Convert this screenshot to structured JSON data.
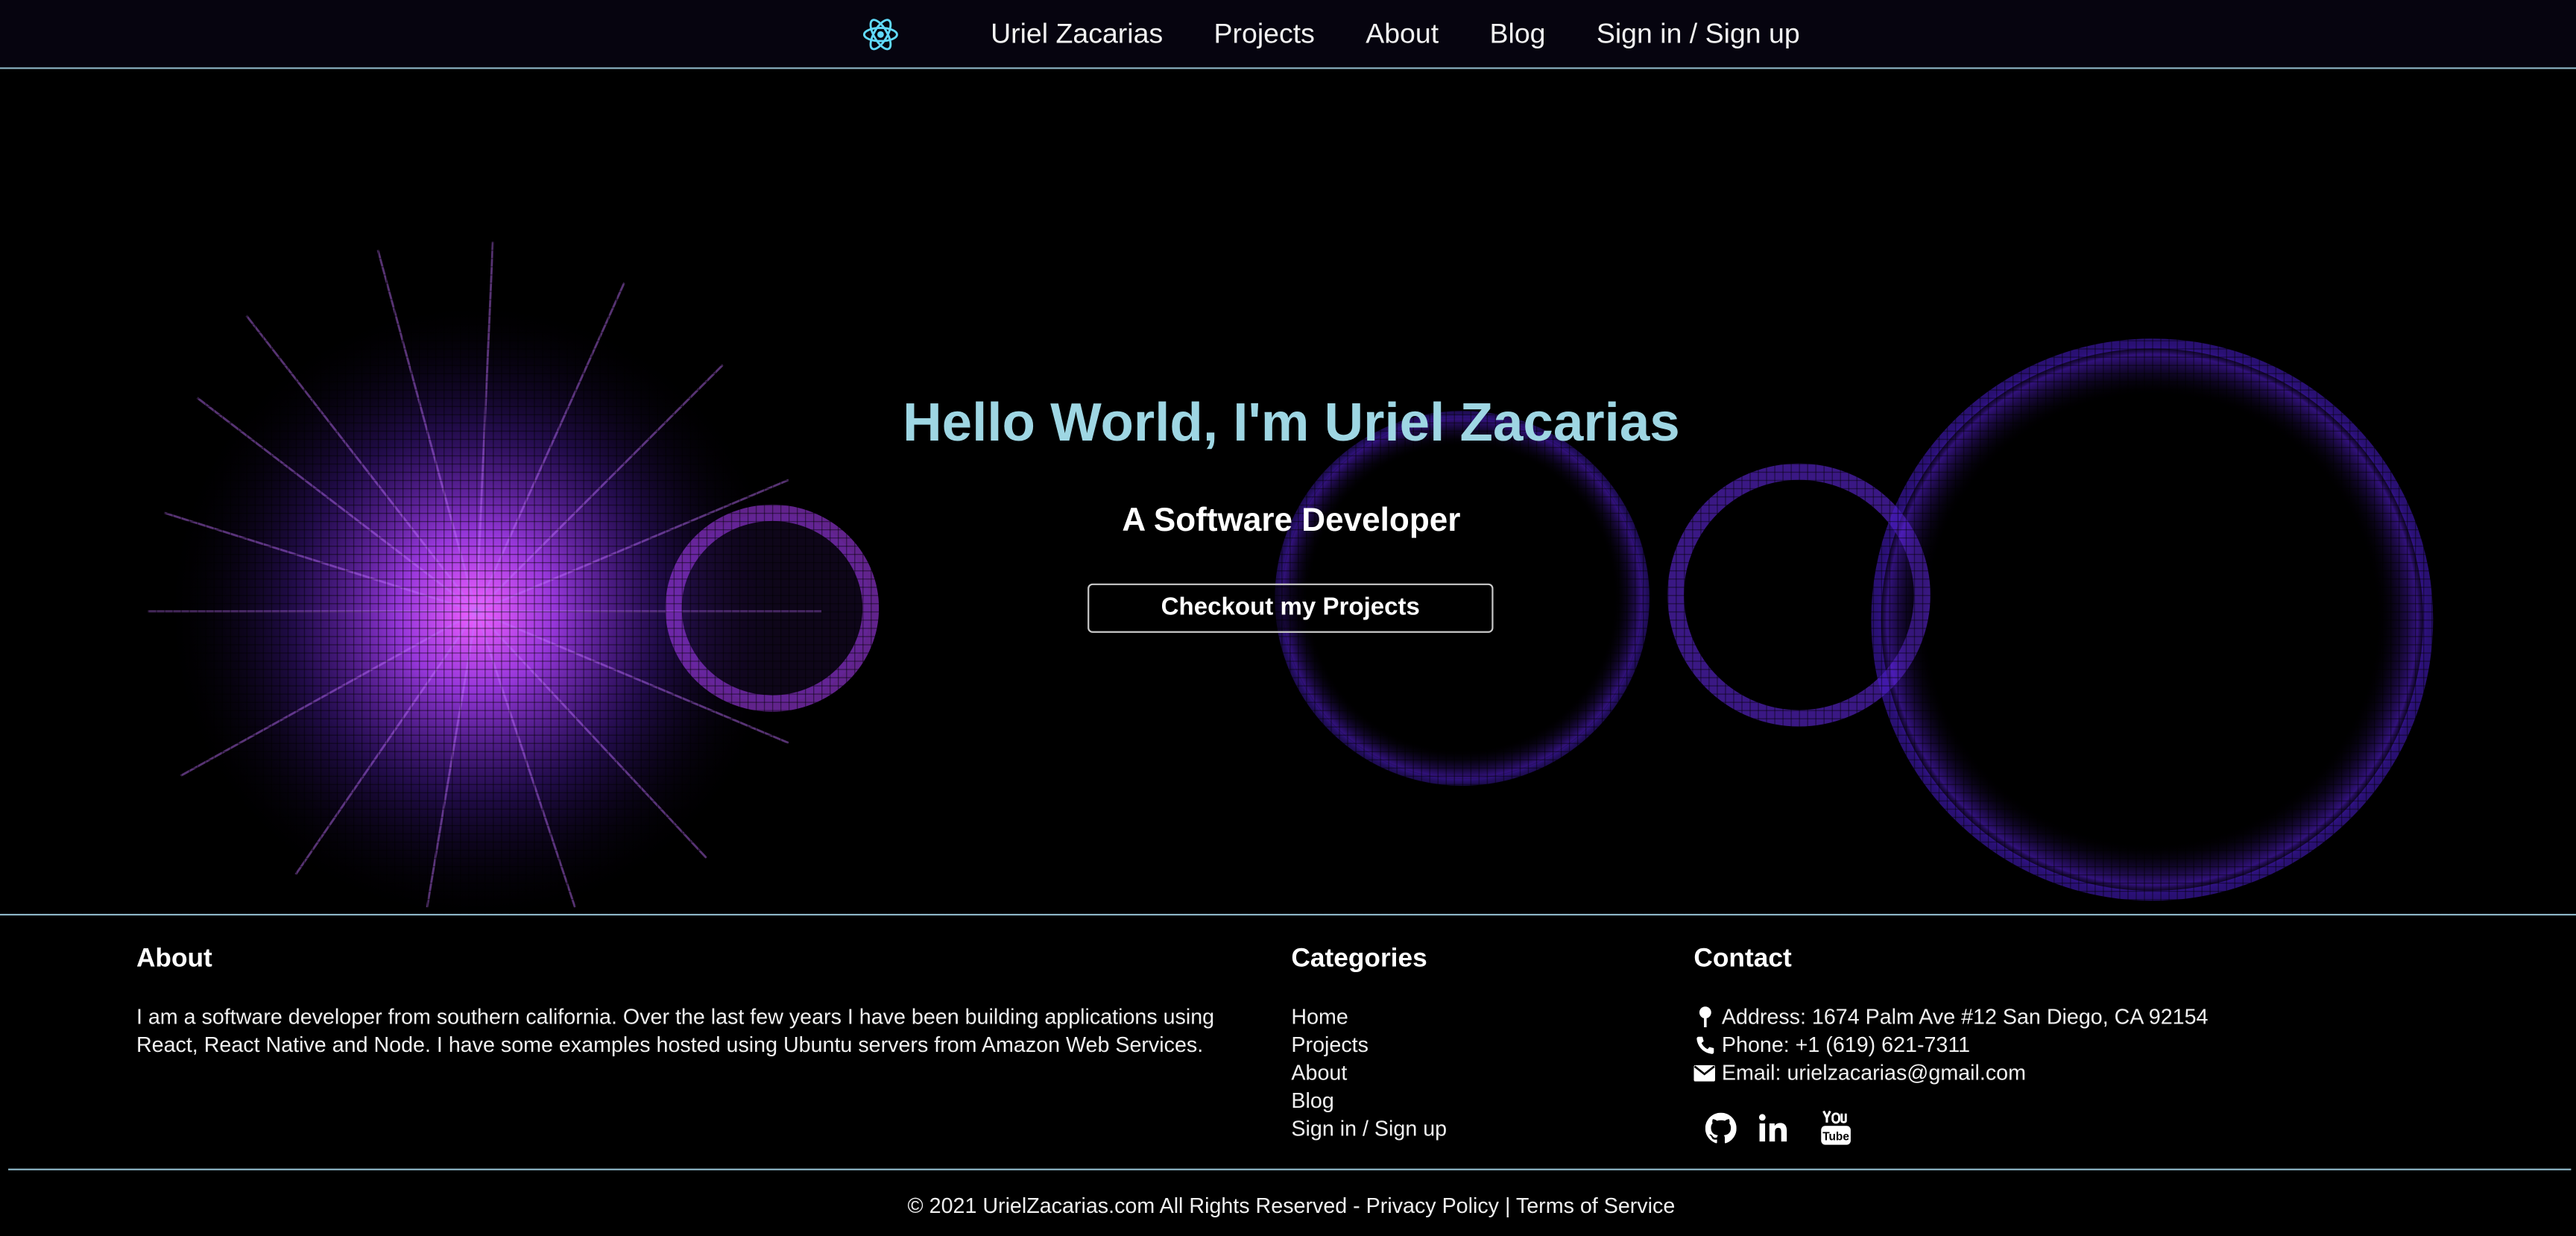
{
  "nav": {
    "logo_icon": "react-atom-icon",
    "links": [
      "Uriel Zacarias",
      "Projects",
      "About",
      "Blog",
      "Sign in / Sign up"
    ]
  },
  "hero": {
    "title": "Hello World, I'm Uriel Zacarias",
    "subtitle": "A Software Developer",
    "button_label": "Checkout my Projects"
  },
  "footer": {
    "about": {
      "heading": "About",
      "text": "I am a software developer from southern california. Over the last few years I have been building applications using React, React Native and Node. I have some examples hosted using Ubuntu servers from Amazon Web Services."
    },
    "categories": {
      "heading": "Categories",
      "items": [
        "Home",
        "Projects",
        "About",
        "Blog",
        "Sign in / Sign up"
      ]
    },
    "contact": {
      "heading": "Contact",
      "address": "Address: 1674 Palm Ave #12 San Diego, CA 92154",
      "phone": "Phone: +1 (619) 621-7311",
      "email": "Email: urielzacarias@gmail.com",
      "socials": [
        "github-icon",
        "linkedin-icon",
        "youtube-icon"
      ]
    },
    "bottom": {
      "copyright": "© 2021 UrielZacarias.com All Rights Reserved - ",
      "privacy": "Privacy Policy",
      "separator": " | ",
      "terms": "Terms of Service"
    }
  },
  "colors": {
    "accent": "#9ed6e3",
    "divider": "#8fb8c9",
    "glow": "#b040ff"
  }
}
